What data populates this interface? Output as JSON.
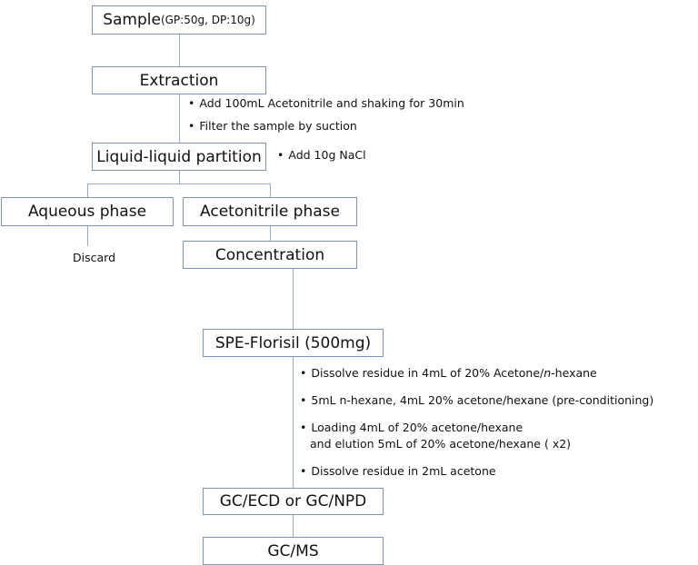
{
  "steps": {
    "sample": {
      "label": "Sample",
      "detail": "(GP:50g, DP:10g)"
    },
    "extraction": "Extraction",
    "partition": "Liquid-liquid partition",
    "aqueous": "Aqueous phase",
    "acetonitrile": "Acetonitrile phase",
    "discard": "Discard",
    "concentration": "Concentration",
    "spe": "SPE-Florisil (500mg)",
    "gc_ecd": "GC/ECD or GC/NPD",
    "gc_ms": "GC/MS"
  },
  "notes": {
    "extraction": [
      "Add 100mL Acetonitrile and shaking for 30min",
      "Filter the sample by suction"
    ],
    "partition": [
      "Add 10g NaCl"
    ],
    "spe_1_pre": "Dissolve residue in 4mL of 20% Acetone/",
    "spe_1_italic": "n",
    "spe_1_post": "-hexane",
    "spe_2": "5mL n-hexane, 4mL 20% acetone/hexane (pre-conditioning)",
    "spe_3a": "Loading 4mL of 20% acetone/hexane",
    "spe_3b": "and elution 5mL of 20% acetone/hexane ( x2)",
    "spe_4": "Dissolve residue in 2mL acetone"
  },
  "bullet": "•",
  "colors": {
    "box_border": "#7f93b3",
    "connector": "#9aa9c5"
  }
}
